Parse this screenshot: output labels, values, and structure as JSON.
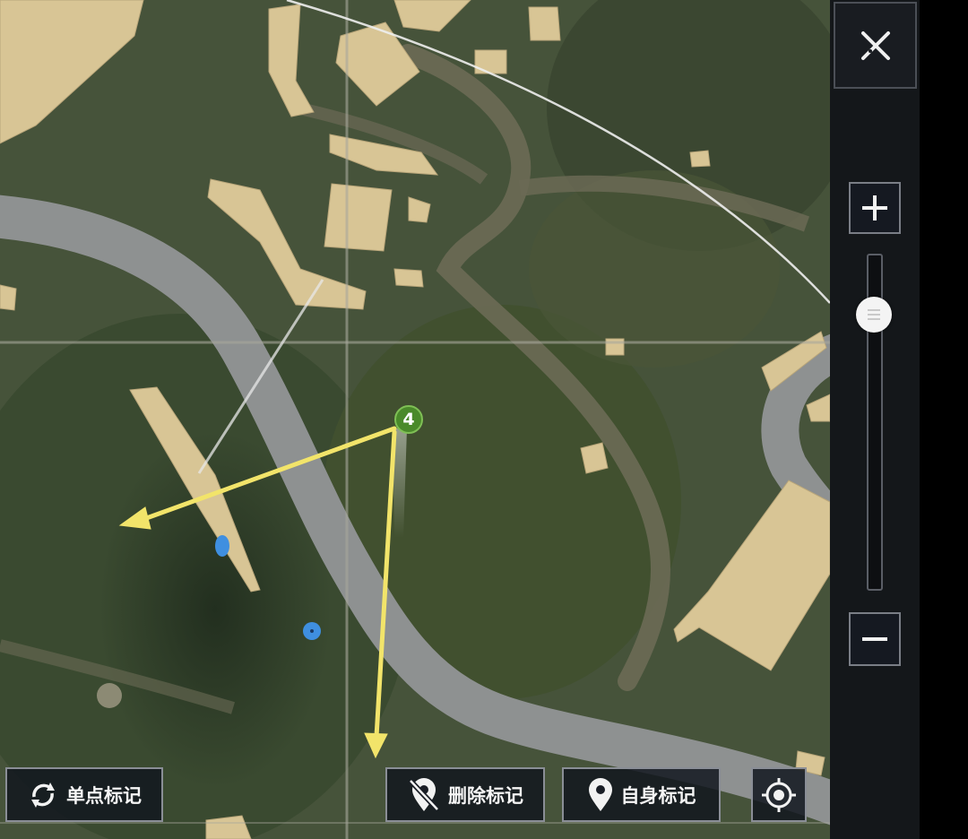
{
  "map": {
    "marker": {
      "number": "4",
      "color": "#4a8a2a"
    },
    "route_color": "#f2e46a",
    "teammate_color": "#3f8fe0"
  },
  "controls": {
    "single_mark_label": "单点标记",
    "delete_mark_label": "删除标记",
    "self_mark_label": "自身标记",
    "zoom_level": 0.18
  },
  "icons": {
    "close": "close-cross-icon",
    "zoom_in": "plus-icon",
    "zoom_out": "minus-icon",
    "single_mark": "refresh-cycle-icon",
    "delete_mark": "location-slash-icon",
    "self_mark": "location-pin-icon",
    "locate": "crosshair-target-icon"
  }
}
